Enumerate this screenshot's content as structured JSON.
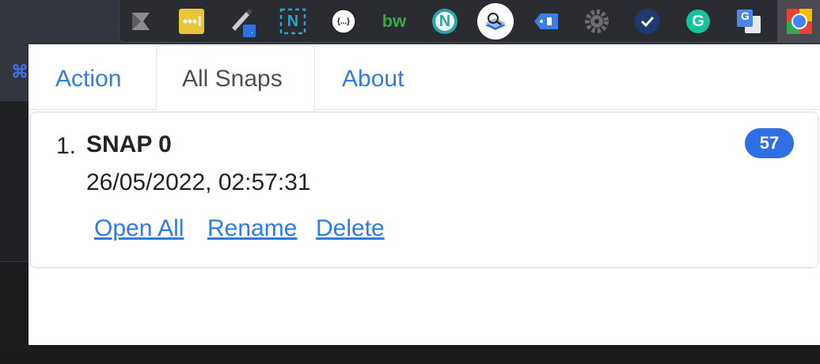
{
  "toolbar": {
    "extensions": [
      {
        "icon": "bookmark-arrow-icon"
      },
      {
        "icon": "dots-bar-icon"
      },
      {
        "icon": "pen-icon",
        "badge": "."
      },
      {
        "icon": "n-bracket-icon",
        "letter": "N"
      },
      {
        "icon": "braces-icon",
        "letter": "{...}"
      },
      {
        "icon": "bw-icon",
        "letter": "bw"
      },
      {
        "icon": "n-circle-icon",
        "letter": "N"
      },
      {
        "icon": "magnifier-stack-icon"
      },
      {
        "icon": "tag-icon"
      },
      {
        "icon": "gear-icon"
      },
      {
        "icon": "checkmark-icon"
      },
      {
        "icon": "grammarly-icon",
        "letter": "G"
      },
      {
        "icon": "translate-icon",
        "letter": "G"
      },
      {
        "icon": "colorful-square-icon"
      }
    ]
  },
  "tabs": [
    {
      "label": "Action"
    },
    {
      "label": "All Snaps"
    },
    {
      "label": "About"
    }
  ],
  "snaps": [
    {
      "number": "1.",
      "name": "SNAP 0",
      "date": "26/05/2022, 02:57:31",
      "count": "57",
      "actions": {
        "open_all": "Open All",
        "rename": "Rename",
        "delete": "Delete"
      }
    }
  ],
  "colors": {
    "accent": "#2f7be8",
    "badge": "#2f6fe6"
  }
}
